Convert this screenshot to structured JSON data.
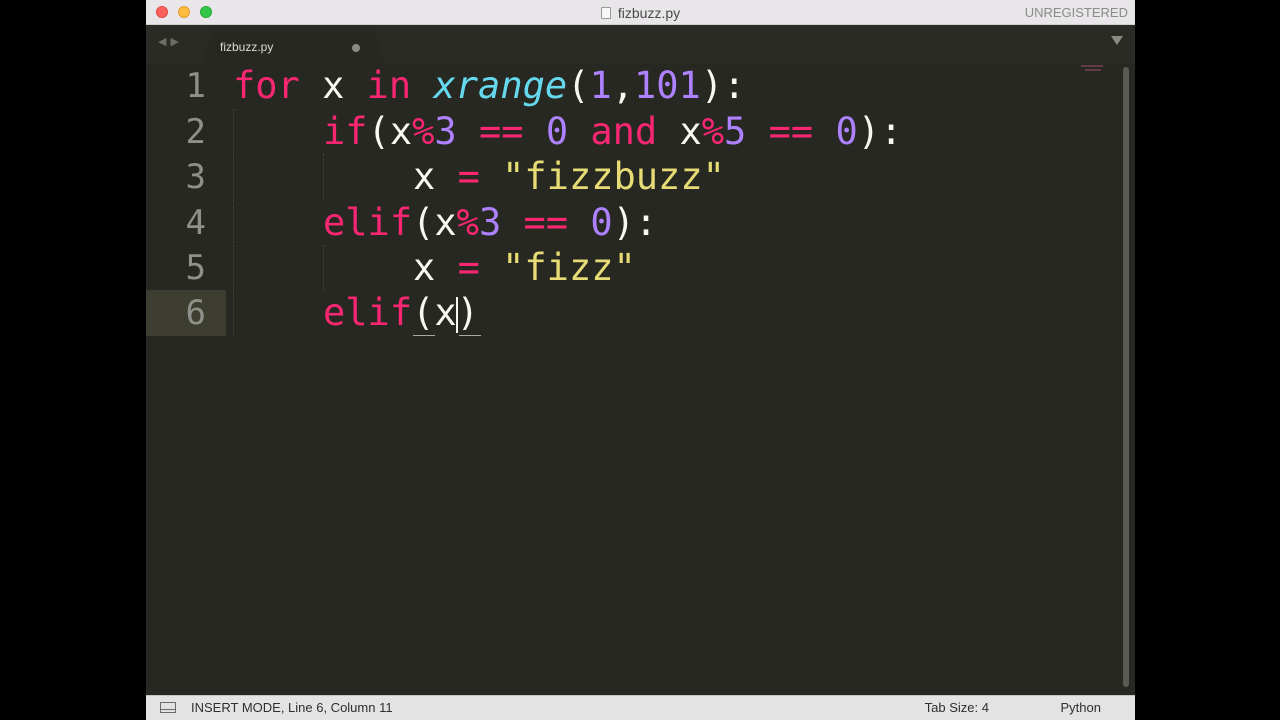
{
  "window": {
    "title": "fizbuzz.py",
    "unregistered_label": "UNREGISTERED"
  },
  "tabs": [
    {
      "label": "fizbuzz.py",
      "modified": true
    }
  ],
  "editor": {
    "current_line": 6,
    "line_numbers": [
      "1",
      "2",
      "3",
      "4",
      "5",
      "6"
    ],
    "lines": {
      "l1": {
        "t1": "for",
        "t2": " x ",
        "t3": "in",
        "t4": " ",
        "t5": "xrange",
        "t6": "(",
        "t7": "1",
        "t8": ",",
        "t9": "101",
        "t10": "):"
      },
      "l2": {
        "t1": "if",
        "t2": "(x",
        "t3": "%",
        "t4": "3",
        "t5": " ",
        "t6": "==",
        "t7": " ",
        "t8": "0",
        "t9": " ",
        "t10": "and",
        "t11": " x",
        "t12": "%",
        "t13": "5",
        "t14": " ",
        "t15": "==",
        "t16": " ",
        "t17": "0",
        "t18": "):"
      },
      "l3": {
        "t1": "x ",
        "t2": "=",
        "t3": " ",
        "t4": "\"fizzbuzz\""
      },
      "l4": {
        "t1": "elif",
        "t2": "(x",
        "t3": "%",
        "t4": "3",
        "t5": " ",
        "t6": "==",
        "t7": " ",
        "t8": "0",
        "t9": "):"
      },
      "l5": {
        "t1": "x ",
        "t2": "=",
        "t3": " ",
        "t4": "\"fizz\""
      },
      "l6": {
        "t1": "elif",
        "t2": "(x",
        "t3": ")"
      }
    }
  },
  "status_bar": {
    "mode_text": "INSERT MODE, Line 6, Column 11",
    "tab_size": "Tab Size: 4",
    "syntax": "Python"
  },
  "colors": {
    "background": "#272822",
    "keyword": "#f92672",
    "function": "#66d9ef",
    "number": "#ae81ff",
    "string": "#e6db74",
    "text": "#f8f8f2",
    "line_number": "#90908a"
  }
}
